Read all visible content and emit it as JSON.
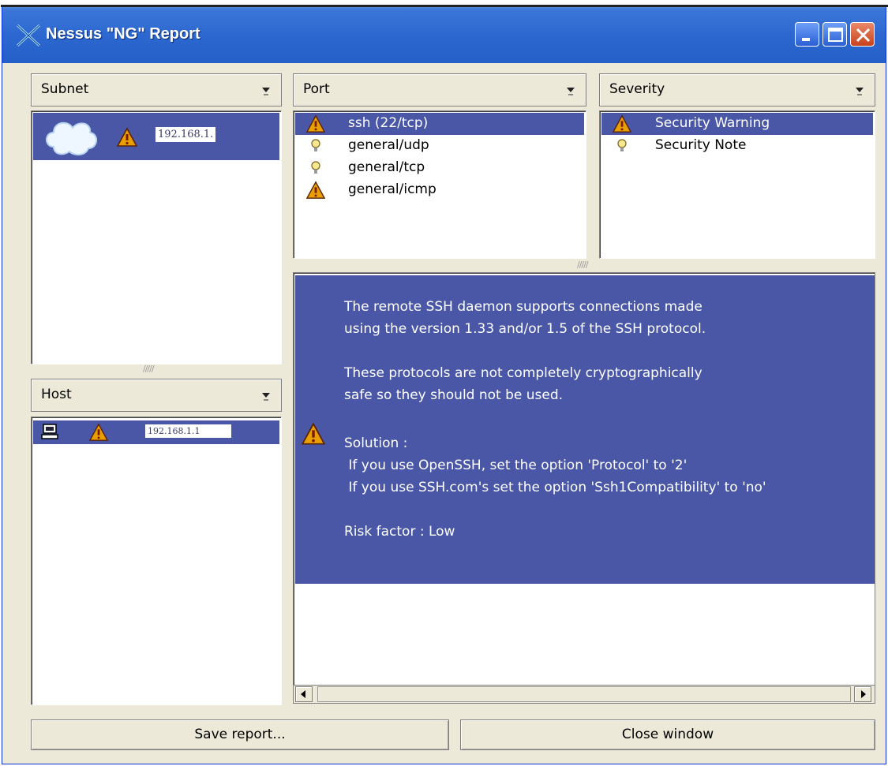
{
  "window": {
    "title": "Nessus \"NG\" Report"
  },
  "subnet": {
    "header": "Subnet",
    "items": [
      {
        "label": "192.168.1.",
        "icon": "cloud-icon",
        "status_icon": "warning-icon",
        "selected": true
      }
    ]
  },
  "host": {
    "header": "Host",
    "items": [
      {
        "label": "192.168.1.1",
        "icon": "computer-icon",
        "status_icon": "warning-icon",
        "selected": true
      }
    ]
  },
  "port": {
    "header": "Port",
    "items": [
      {
        "label": "ssh (22/tcp)",
        "icon": "warning-icon",
        "selected": true
      },
      {
        "label": "general/udp",
        "icon": "lightbulb-icon",
        "selected": false
      },
      {
        "label": "general/tcp",
        "icon": "lightbulb-icon",
        "selected": false
      },
      {
        "label": "general/icmp",
        "icon": "warning-icon",
        "selected": false
      }
    ]
  },
  "severity": {
    "header": "Severity",
    "items": [
      {
        "label": "Security Warning",
        "icon": "warning-icon",
        "selected": true
      },
      {
        "label": "Security Note",
        "icon": "lightbulb-icon",
        "selected": false
      }
    ]
  },
  "detail": {
    "icon": "warning-icon",
    "lines": [
      "The remote SSH daemon supports connections made",
      "using the version 1.33 and/or 1.5 of the SSH protocol.",
      "",
      "These protocols are not completely cryptographically",
      "safe so they should not be used.",
      "",
      "Solution :",
      " If you use OpenSSH, set the option 'Protocol' to '2'",
      " If you use SSH.com's set the option 'Ssh1Compatibility' to 'no'",
      "",
      "Risk factor : Low"
    ]
  },
  "buttons": {
    "save": "Save report...",
    "close": "Close window"
  },
  "colors": {
    "selection": "#4a57a6",
    "titlebar": "#2c68d0",
    "face": "#ece9d8"
  }
}
